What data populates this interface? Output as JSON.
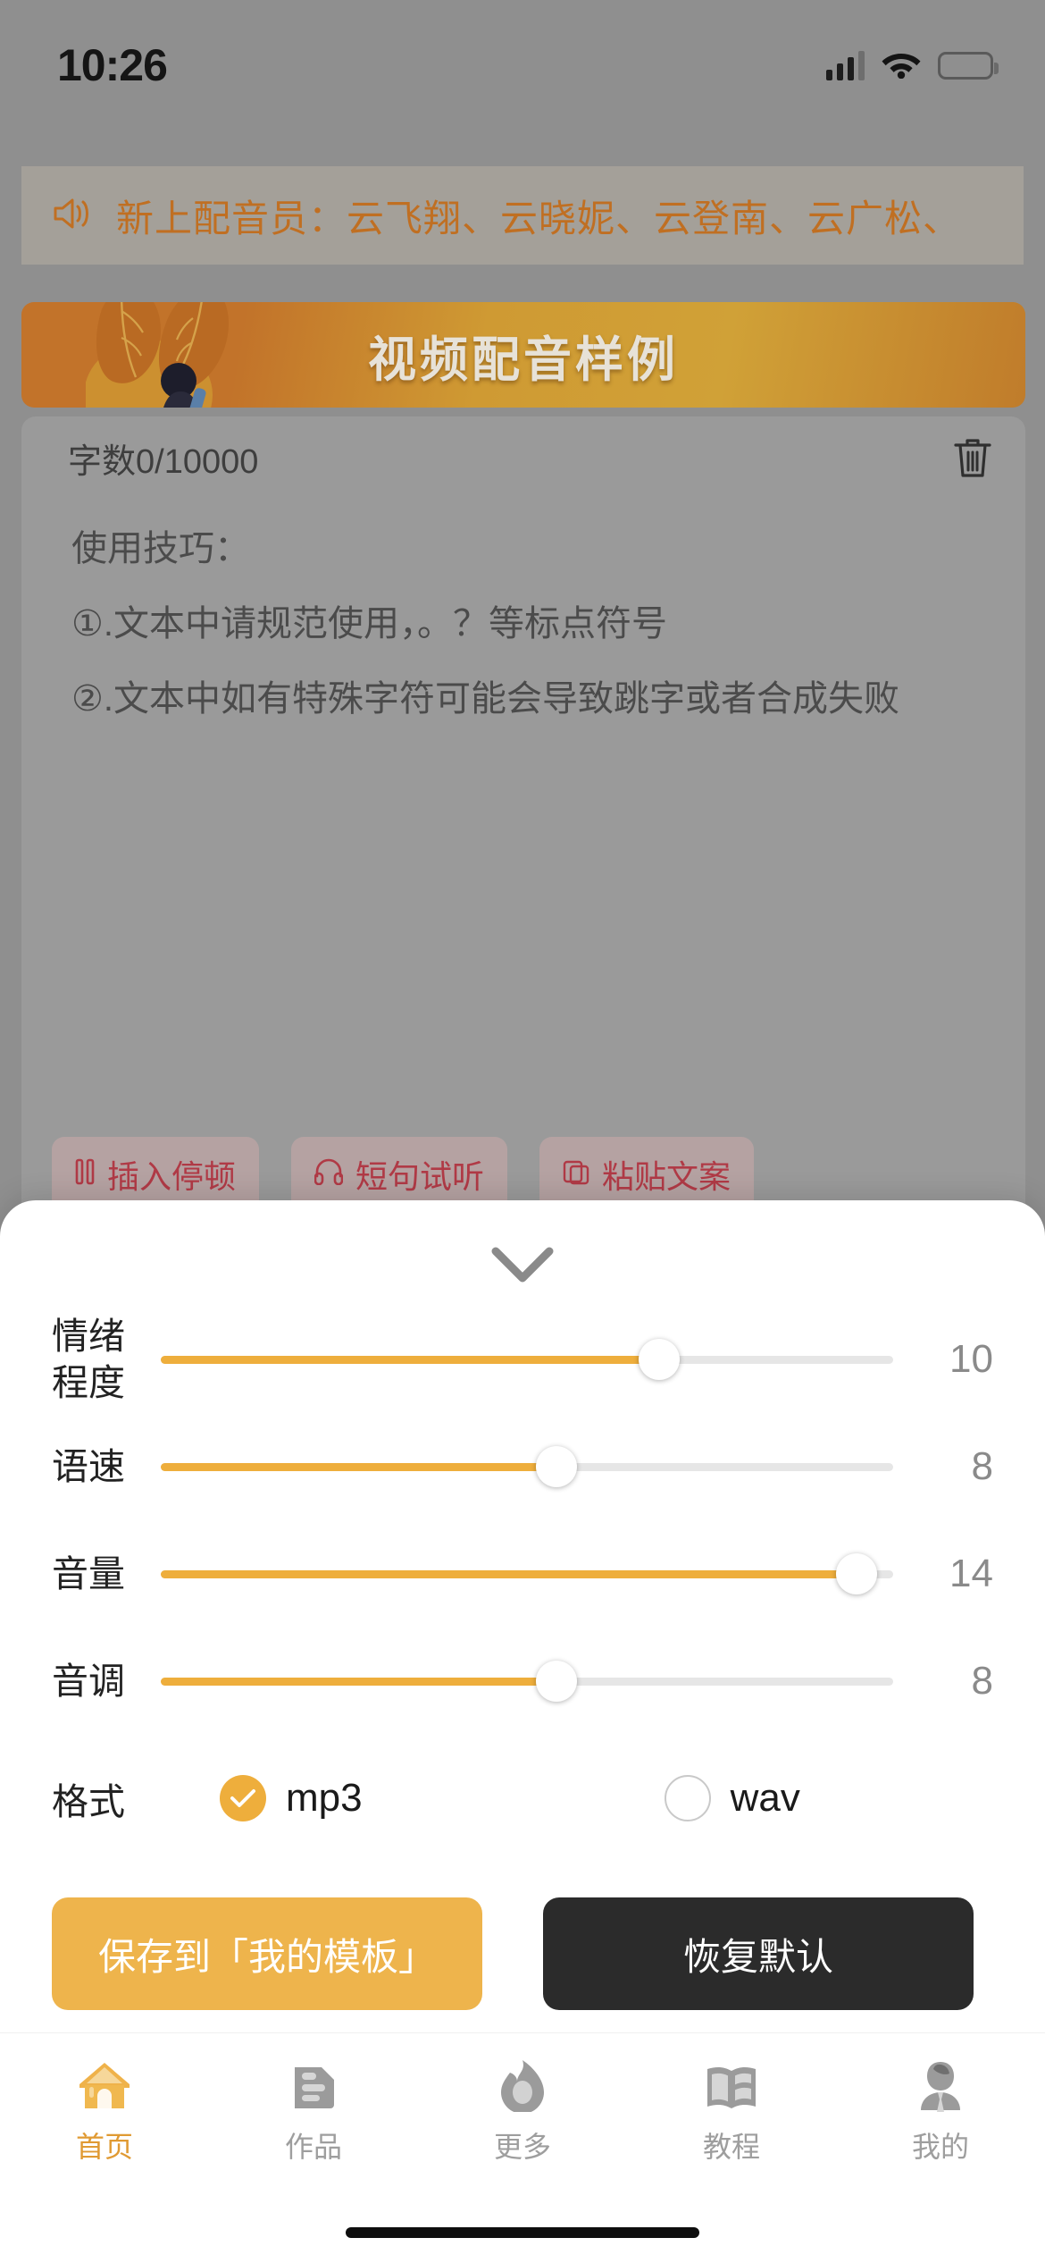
{
  "status_bar": {
    "time": "10:26",
    "signal_icon": "cellular-signal-icon",
    "wifi_icon": "wifi-icon",
    "battery_icon": "battery-icon"
  },
  "notice": {
    "speaker_icon": "speaker-icon",
    "text": "新上配音员：云飞翔、云晓妮、云登南、云广松、"
  },
  "promo_banner": {
    "title": "视频配音样例"
  },
  "editor": {
    "word_count": "字数0/10000",
    "delete_icon": "trash-icon",
    "tips_heading": "使用技巧：",
    "tips": [
      "①.文本中请规范使用，。？等标点符号",
      "②.文本中如有特殊字符可能会导致跳字或者合成失败"
    ],
    "toolbar": [
      {
        "label": "插入停顿",
        "icon": "pause-icon"
      },
      {
        "label": "短句试听",
        "icon": "headphones-icon"
      },
      {
        "label": "粘贴文案",
        "icon": "paste-icon"
      }
    ]
  },
  "sheet": {
    "collapse_icon": "chevron-down-icon",
    "sliders": [
      {
        "label": "情绪\n程度",
        "label_line1": "情绪",
        "label_line2": "程度",
        "value": "10",
        "percent": 68
      },
      {
        "label": "语速",
        "label_line1": "语速",
        "label_line2": "",
        "value": "8",
        "percent": 54
      },
      {
        "label": "音量",
        "label_line1": "音量",
        "label_line2": "",
        "value": "14",
        "percent": 95
      },
      {
        "label": "音调",
        "label_line1": "音调",
        "label_line2": "",
        "value": "8",
        "percent": 54
      }
    ],
    "format": {
      "label": "格式",
      "options": [
        {
          "value": "mp3",
          "selected": true,
          "icon": "check-icon"
        },
        {
          "value": "wav",
          "selected": false,
          "icon": "radio-empty-icon"
        }
      ]
    },
    "actions": {
      "save_label": "保存到「我的模板」",
      "restore_label": "恢复默认"
    }
  },
  "tab_bar": {
    "active_index": 0,
    "items": [
      {
        "label": "首页",
        "icon": "home-icon"
      },
      {
        "label": "作品",
        "icon": "works-document-icon"
      },
      {
        "label": "更多",
        "icon": "flame-icon"
      },
      {
        "label": "教程",
        "icon": "book-icon"
      },
      {
        "label": "我的",
        "icon": "person-icon"
      }
    ]
  },
  "colors": {
    "accent_orange": "#eeae3c",
    "notice_orange": "#c06f22",
    "dark_button": "#2b2b2b",
    "chip_red": "#b03a46"
  }
}
